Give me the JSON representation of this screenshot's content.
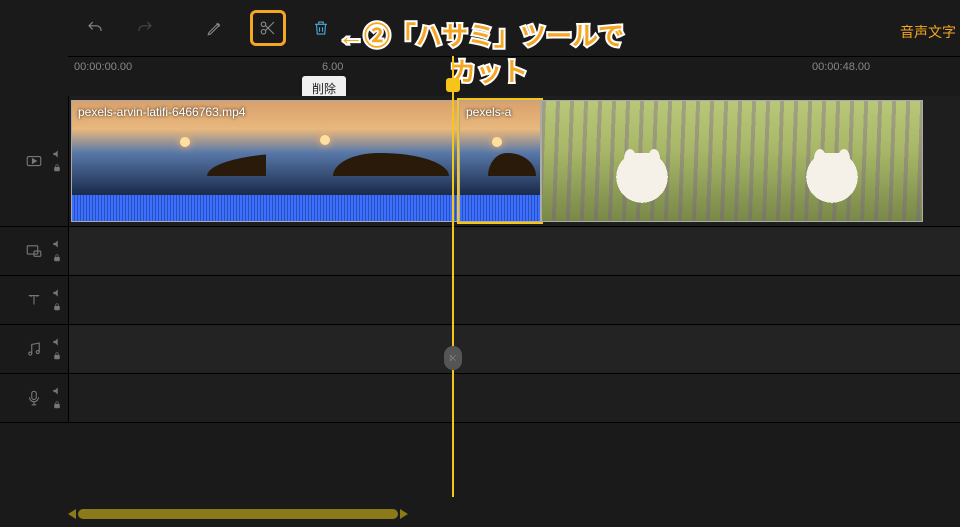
{
  "toolbar": {
    "tooltip_delete": "削除"
  },
  "ruler": {
    "t0": "00:00:00.00",
    "t1": "6.00",
    "t2": "00:00:48.00"
  },
  "clips": {
    "clip1_name": "pexels-arvin-latifi-6466763.mp4",
    "clip2_name": "pexels-a"
  },
  "top_right_text": "音声文字",
  "annotation": {
    "line1": "←②「ハサミ」ツールで",
    "line2": "カット"
  }
}
